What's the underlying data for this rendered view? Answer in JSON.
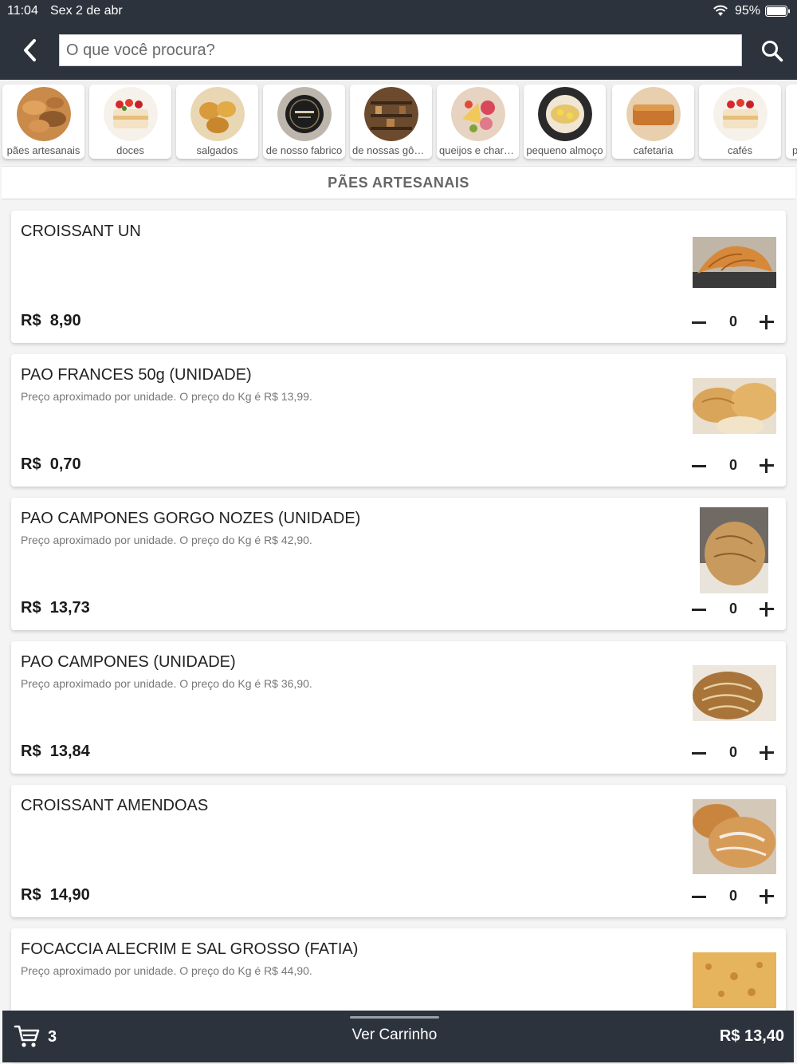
{
  "status_bar": {
    "time": "11:04",
    "date": "Sex 2 de abr",
    "battery": "95%"
  },
  "search": {
    "placeholder": "O que você procura?"
  },
  "categories": [
    {
      "label": "pães artesanais"
    },
    {
      "label": "doces"
    },
    {
      "label": "salgados"
    },
    {
      "label": "de nosso fabrico"
    },
    {
      "label": "de nossas gôndolas"
    },
    {
      "label": "queijos e charcutaria"
    },
    {
      "label": "pequeno almoço"
    },
    {
      "label": "cafetaria"
    },
    {
      "label": "cafés"
    },
    {
      "label": "p"
    }
  ],
  "section_title": "PÃES ARTESANAIS",
  "products": [
    {
      "name": "CROISSANT UN",
      "description": "",
      "currency": "R$",
      "price": "8,90",
      "quantity": "0"
    },
    {
      "name": "PAO FRANCES 50g (UNIDADE)",
      "description": "Preço aproximado por unidade. O preço do Kg é R$ 13,99.",
      "currency": "R$",
      "price": "0,70",
      "quantity": "0"
    },
    {
      "name": "PAO CAMPONES GORGO NOZES (UNIDADE)",
      "description": "Preço aproximado por unidade. O preço do Kg é R$ 42,90.",
      "currency": "R$",
      "price": "13,73",
      "quantity": "0"
    },
    {
      "name": "PAO CAMPONES (UNIDADE)",
      "description": "Preço aproximado por unidade. O preço do Kg é R$ 36,90.",
      "currency": "R$",
      "price": "13,84",
      "quantity": "0"
    },
    {
      "name": "CROISSANT AMENDOAS",
      "description": "",
      "currency": "R$",
      "price": "14,90",
      "quantity": "0"
    },
    {
      "name": "FOCACCIA ALECRIM E SAL GROSSO (FATIA)",
      "description": "Preço aproximado por unidade. O preço do Kg é R$ 44,90.",
      "currency": "R$",
      "price": "",
      "quantity": ""
    }
  ],
  "cart": {
    "count": "3",
    "view_label": "Ver Carrinho",
    "total": "R$ 13,40"
  },
  "colors": {
    "header": "#2c333d",
    "background": "#f4f4f4",
    "card": "#ffffff",
    "text": "#222222"
  }
}
